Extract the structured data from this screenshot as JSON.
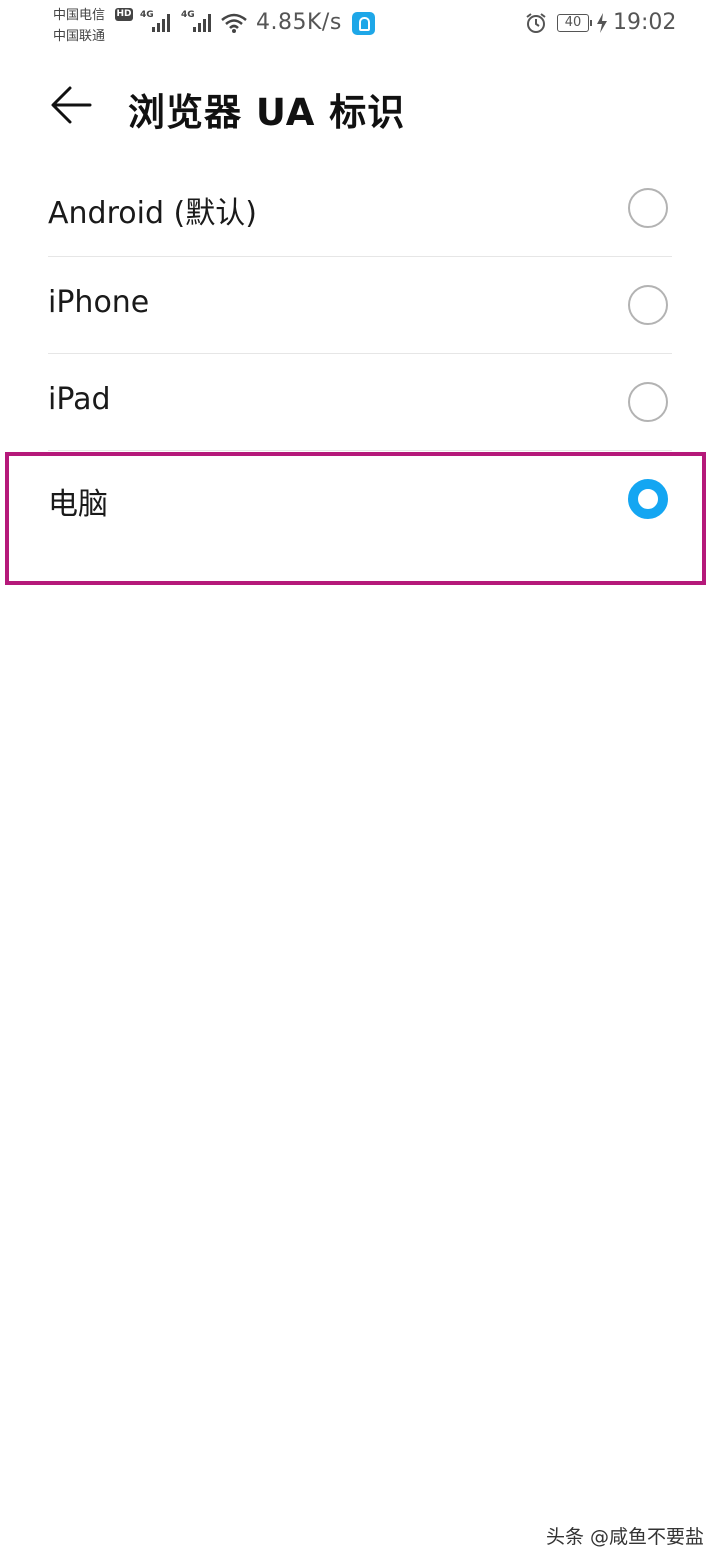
{
  "status_bar": {
    "carrier_1": "中国电信",
    "carrier_2": "中国联通",
    "hd_badge": "HD",
    "network_1": "4G",
    "network_2": "4G",
    "speed": "4.85K/s",
    "battery": "40",
    "time": "19:02",
    "icons": [
      "signal-icon",
      "wifi-icon",
      "app-notification-icon",
      "alarm-icon",
      "battery-icon",
      "charging-icon"
    ]
  },
  "header": {
    "title": "浏览器 UA 标识",
    "back_icon": "back-arrow-icon"
  },
  "options": [
    {
      "label": "Android (默认)",
      "selected": false
    },
    {
      "label": "iPhone",
      "selected": false
    },
    {
      "label": "iPad",
      "selected": false
    },
    {
      "label": "电脑",
      "selected": true
    }
  ],
  "colors": {
    "accent": "#14a6f2",
    "highlight_border": "#b5197a",
    "divider": "#e6e6e6"
  },
  "watermark": "头条 @咸鱼不要盐"
}
